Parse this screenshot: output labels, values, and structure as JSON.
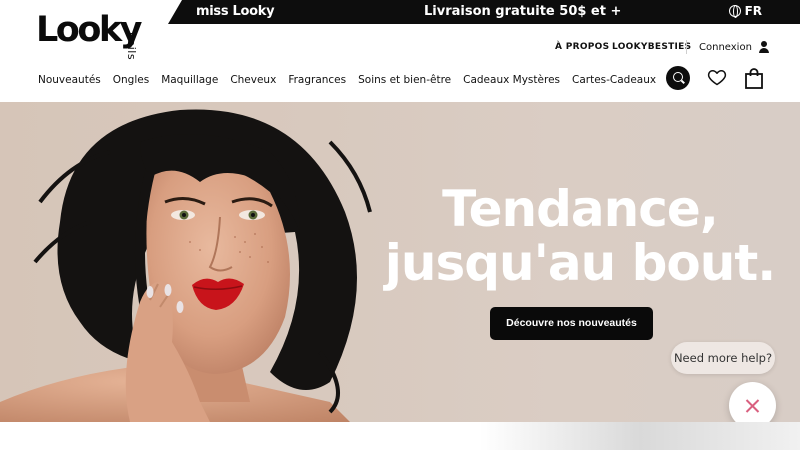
{
  "promo": {
    "brand": "miss Looky",
    "text": "Livraison gratuite 50$ et +",
    "language": "FR"
  },
  "logo": {
    "main": "Looky",
    "sub": "nails"
  },
  "utility": {
    "about": "À PROPOS",
    "besties": "LOOKYBESTIES",
    "login": "Connexion"
  },
  "nav": [
    "Nouveautés",
    "Ongles",
    "Maquillage",
    "Cheveux",
    "Fragrances",
    "Soins et bien-être",
    "Cadeaux Mystères",
    "Cartes-Cadeaux"
  ],
  "icons": {
    "search": "search-icon",
    "wishlist": "heart-icon",
    "cart": "shopping-bag-icon",
    "language": "globe-icon",
    "account": "user-icon",
    "close": "close-icon"
  },
  "hero": {
    "title_line1": "Tendance,",
    "title_line2": "jusqu'au bout.",
    "cta": "Découvre nos nouveautés"
  },
  "chat": {
    "prompt": "Need more help?"
  },
  "colors": {
    "black": "#0d0d0d",
    "hero_bg": "#d8c9be",
    "lip_red": "#c8141b",
    "close_accent": "#d9607f"
  }
}
